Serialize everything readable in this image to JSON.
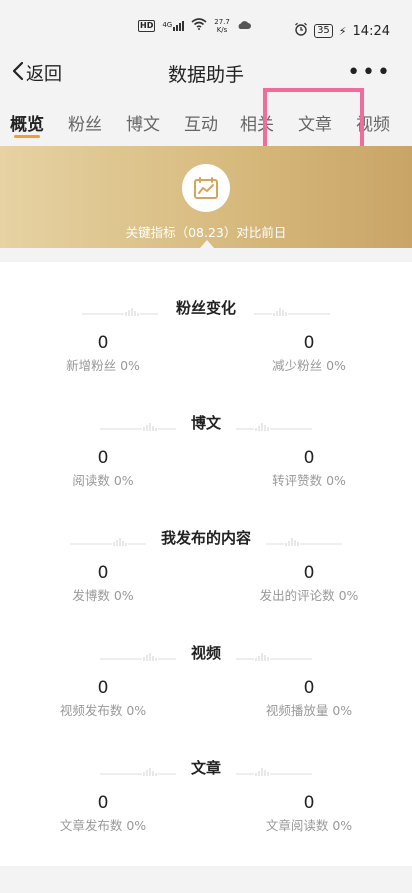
{
  "status_bar": {
    "hd": "HD",
    "network": "4G",
    "speed_value": "27.7",
    "speed_unit": "K/s",
    "battery": "35",
    "time": "14:24"
  },
  "nav": {
    "back_label": "返回",
    "title": "数据助手",
    "more": "•••"
  },
  "tabs": [
    "概览",
    "粉丝",
    "博文",
    "互动",
    "相关",
    "文章",
    "视频"
  ],
  "banner": {
    "text": "关键指标（08.23）对比前日"
  },
  "sections": [
    {
      "title": "粉丝变化",
      "left": {
        "value": "0",
        "label": "新增粉丝",
        "pct": "0%"
      },
      "right": {
        "value": "0",
        "label": "减少粉丝",
        "pct": "0%"
      }
    },
    {
      "title": "博文",
      "left": {
        "value": "0",
        "label": "阅读数",
        "pct": "0%"
      },
      "right": {
        "value": "0",
        "label": "转评赞数",
        "pct": "0%"
      }
    },
    {
      "title": "我发布的内容",
      "left": {
        "value": "0",
        "label": "发博数",
        "pct": "0%"
      },
      "right": {
        "value": "0",
        "label": "发出的评论数",
        "pct": "0%"
      }
    },
    {
      "title": "视频",
      "left": {
        "value": "0",
        "label": "视频发布数",
        "pct": "0%"
      },
      "right": {
        "value": "0",
        "label": "视频播放量",
        "pct": "0%"
      }
    },
    {
      "title": "文章",
      "left": {
        "value": "0",
        "label": "文章发布数",
        "pct": "0%"
      },
      "right": {
        "value": "0",
        "label": "文章阅读数",
        "pct": "0%"
      }
    }
  ],
  "colors": {
    "accent": "#f0a030",
    "highlight_box": "#f06c9c",
    "banner_start": "#e6d2a3",
    "banner_end": "#c9a467"
  }
}
